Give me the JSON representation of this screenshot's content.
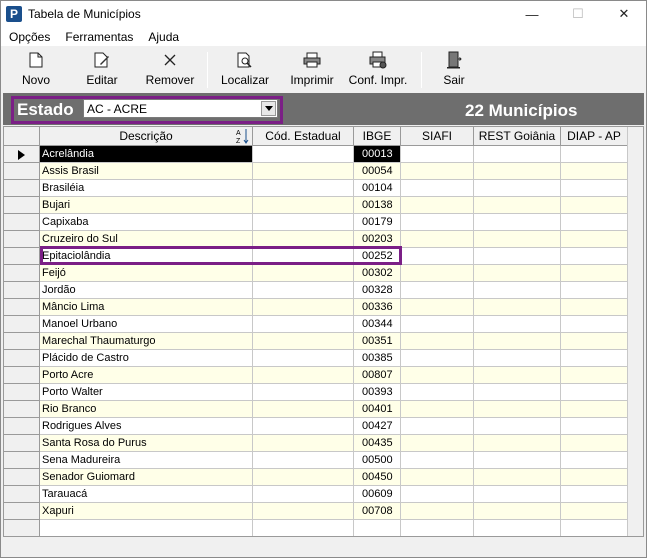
{
  "window": {
    "title": "Tabela de Municípios",
    "icon_letter": "P",
    "min_glyph": "—",
    "max_glyph": "☐",
    "close_glyph": "✕"
  },
  "menu": [
    "Opções",
    "Ferramentas",
    "Ajuda"
  ],
  "toolbar": {
    "novo": "Novo",
    "editar": "Editar",
    "remover": "Remover",
    "localizar": "Localizar",
    "imprimir": "Imprimir",
    "conf_impr": "Conf. Impr.",
    "sair": "Sair"
  },
  "state": {
    "label": "Estado",
    "selected": "AC - ACRE",
    "count_text": "22 Municípios"
  },
  "grid": {
    "columns": [
      "Descrição",
      "Cód. Estadual",
      "IBGE",
      "SIAFI",
      "REST Goiânia",
      "DIAP - AP"
    ],
    "rows": [
      {
        "desc": "Acrelândia",
        "ibge": "00013"
      },
      {
        "desc": "Assis Brasil",
        "ibge": "00054"
      },
      {
        "desc": "Brasiléia",
        "ibge": "00104"
      },
      {
        "desc": "Bujari",
        "ibge": "00138"
      },
      {
        "desc": "Capixaba",
        "ibge": "00179"
      },
      {
        "desc": "Cruzeiro do Sul",
        "ibge": "00203"
      },
      {
        "desc": "Epitaciolândia",
        "ibge": "00252"
      },
      {
        "desc": "Feijó",
        "ibge": "00302"
      },
      {
        "desc": "Jordão",
        "ibge": "00328"
      },
      {
        "desc": "Mâncio Lima",
        "ibge": "00336"
      },
      {
        "desc": "Manoel Urbano",
        "ibge": "00344"
      },
      {
        "desc": "Marechal Thaumaturgo",
        "ibge": "00351"
      },
      {
        "desc": "Plácido de Castro",
        "ibge": "00385"
      },
      {
        "desc": "Porto Acre",
        "ibge": "00807"
      },
      {
        "desc": "Porto Walter",
        "ibge": "00393"
      },
      {
        "desc": "Rio Branco",
        "ibge": "00401"
      },
      {
        "desc": "Rodrigues Alves",
        "ibge": "00427"
      },
      {
        "desc": "Santa Rosa do Purus",
        "ibge": "00435"
      },
      {
        "desc": "Sena Madureira",
        "ibge": "00500"
      },
      {
        "desc": "Senador Guiomard",
        "ibge": "00450"
      },
      {
        "desc": "Tarauacá",
        "ibge": "00609"
      },
      {
        "desc": "Xapuri",
        "ibge": "00708"
      }
    ]
  },
  "colors": {
    "highlight": "#7b1f86",
    "state_bar": "#6e6e6e",
    "row_alt": "#ffffe8",
    "selected_row": "#000000"
  }
}
